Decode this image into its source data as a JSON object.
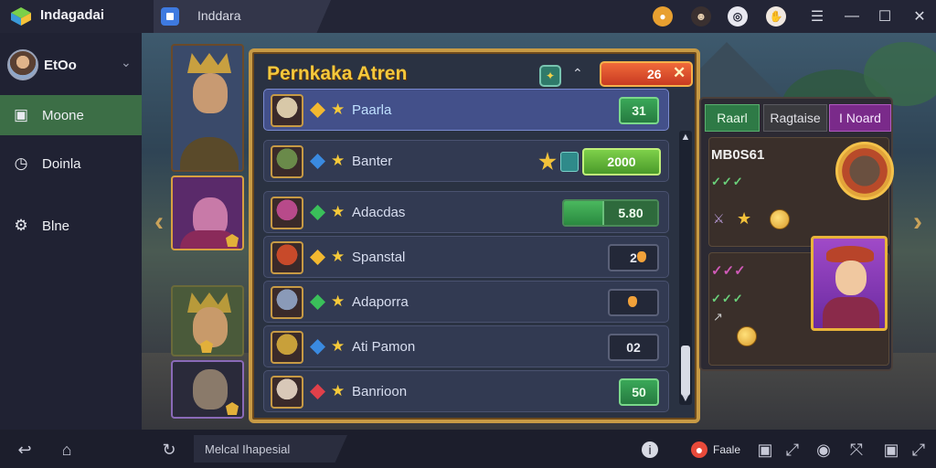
{
  "titlebar": {
    "app_name": "Indagadai",
    "tab_label": "Inddara",
    "icons": [
      "coin-icon",
      "mask-icon",
      "record-icon",
      "hand-icon"
    ],
    "window_controls": [
      "menu-icon",
      "minimize-icon",
      "maximize-icon",
      "close-icon"
    ]
  },
  "sidebar": {
    "profile_name": "EtOo",
    "items": [
      {
        "label": "Moone",
        "icon": "window-icon",
        "active": true
      },
      {
        "label": "Doinla",
        "icon": "clock-icon",
        "active": false
      },
      {
        "label": "Blne",
        "icon": "gear-icon",
        "active": false
      }
    ]
  },
  "panel": {
    "title": "Pernkaka Atren",
    "close_value": "26",
    "rows": [
      {
        "name": "Paarla",
        "value": "31",
        "style": "green",
        "highlight": true,
        "gem": "gold",
        "portrait": "#d8c8a8"
      },
      {
        "name": "Banter",
        "value": "2000",
        "style": "bright",
        "highlight": false,
        "gem": "blue",
        "portrait": "#6a8a4a"
      },
      {
        "name": "Adacdas",
        "value": "5.80",
        "style": "progress",
        "progress": 0.42,
        "highlight": false,
        "gem": "green",
        "portrait": "#b84a8a"
      },
      {
        "name": "Spanstal",
        "value": "2",
        "style": "dark",
        "highlight": false,
        "gem": "gold",
        "portrait": "#c84a2a"
      },
      {
        "name": "Adaporra",
        "value": "",
        "style": "dark",
        "highlight": false,
        "gem": "green",
        "portrait": "#8a9ab8"
      },
      {
        "name": "Ati Pamon",
        "value": "02",
        "style": "dark",
        "highlight": false,
        "gem": "blue",
        "portrait": "#c8a03a"
      },
      {
        "name": "Banrioon",
        "value": "50",
        "style": "green",
        "highlight": false,
        "gem": "red",
        "portrait": "#d8c8b8"
      }
    ]
  },
  "right_panel": {
    "tabs": [
      {
        "label": "Raarl",
        "color": "#2e7a46"
      },
      {
        "label": "Ragtaise",
        "color": "#3a3a3e"
      },
      {
        "label": "I Noard",
        "color": "#7a2a8a"
      }
    ],
    "code": "MB0S61",
    "checks_1": "✓✓✓",
    "magenta_text": "✓✓✓",
    "checks_2": "✓✓✓"
  },
  "bottombar": {
    "input_text": "Melcal Ihapesial",
    "badge_label": "Faale"
  }
}
